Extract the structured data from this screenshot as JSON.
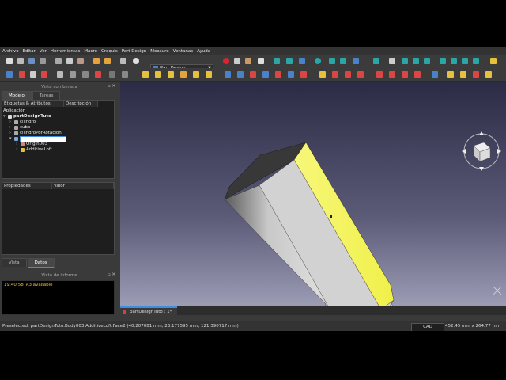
{
  "menu": [
    "Archivo",
    "Editar",
    "Ver",
    "Herramientas",
    "Macro",
    "Croquis",
    "Part Design",
    "Measure",
    "Ventanas",
    "Ayuda"
  ],
  "workbench": "Part Design",
  "combo": {
    "title": "Vista combinada",
    "tabs": [
      "Modelo",
      "Tareas"
    ],
    "headers": [
      "Etiquetas & Atributos",
      "Descripción"
    ],
    "app_label": "Aplicación",
    "tree": [
      {
        "label": "partDesignTuto",
        "depth": 0,
        "expanded": true
      },
      {
        "label": "cilindro",
        "depth": 1,
        "expanded": false
      },
      {
        "label": "cubo",
        "depth": 1,
        "expanded": false
      },
      {
        "label": "cilindroPorRotacion",
        "depth": 1,
        "expanded": false
      },
      {
        "label": "",
        "depth": 1,
        "expanded": true,
        "editing": true
      },
      {
        "label": "Origin003",
        "depth": 2,
        "expanded": false
      },
      {
        "label": "AdditiveLoft",
        "depth": 2,
        "expanded": false
      }
    ],
    "props_headers": [
      "Propiedades",
      "Valor"
    ],
    "bottom_tabs": [
      "Vista",
      "Datos"
    ]
  },
  "report": {
    "title": "Vista de informe",
    "time": "19:40:58",
    "message": "A3 available"
  },
  "document_tab": "partDesignTuto : 1*",
  "status": {
    "message": "Preselected: partDesignTuto.Body003.AdditiveLoft.Face2 (40.207081 mm, 23.177595 mm, 121.390717 mm)",
    "nav_style": "CAD",
    "dimensions": "452.45 mm x 264.77 mm"
  },
  "colors": {
    "selected_face": "#f5f55a",
    "accent": "#3d8ee0"
  }
}
